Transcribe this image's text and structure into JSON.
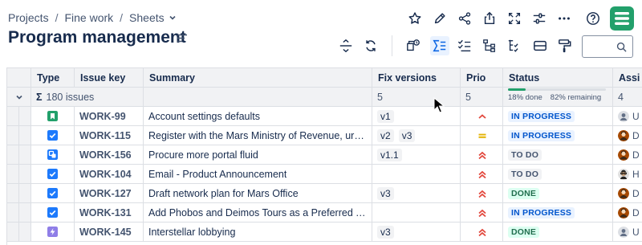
{
  "breadcrumb": {
    "items": [
      "Projects",
      "Fine work",
      "Sheets"
    ],
    "separator": "/"
  },
  "page": {
    "title": "Program management"
  },
  "search": {
    "value": ""
  },
  "icons": {
    "top": [
      "star-icon",
      "edit-icon",
      "share-icon",
      "export-icon",
      "fullscreen-icon",
      "settings-sliders-icon",
      "more-icon",
      "help-icon"
    ],
    "toolbar": [
      "expand-collapse-icon",
      "refresh-icon",
      "filter-icon",
      "sum-icon",
      "checklist-icon",
      "hierarchy-icon",
      "group-icon",
      "card-icon",
      "paint-roller-icon"
    ]
  },
  "colors": {
    "accent": "#0c66e4",
    "brand": "#22a06b",
    "done": "#216e4e",
    "inprogress": "#0055cc"
  },
  "grid": {
    "columns": {
      "type": "Type",
      "key": "Issue key",
      "summary": "Summary",
      "fix_versions": "Fix versions",
      "prio": "Prio",
      "status": "Status",
      "assignee": "Assi"
    },
    "summary_row": {
      "sigma": "Σ",
      "issues": "180 issues",
      "fix_versions_count": "5",
      "prio_count": "5",
      "status_done_label": "18% done",
      "status_remaining_label": "82% remaining",
      "done_fraction": 0.18,
      "assignee_count": "4"
    },
    "rows": [
      {
        "type": "story",
        "key": "WORK-99",
        "summary": "Account settings defaults",
        "versions": [
          "v1"
        ],
        "priority": "medium",
        "status": "IN PROGRESS",
        "status_kind": "inprogress",
        "assignee_avatar": "generic",
        "assignee": "U"
      },
      {
        "type": "task",
        "key": "WORK-115",
        "summary": "Register with the Mars Ministry of Revenue, urge...",
        "versions": [
          "v2",
          "v3"
        ],
        "priority": "medium-equal",
        "status": "IN PROGRESS",
        "status_kind": "inprogress",
        "assignee_avatar": "person",
        "assignee": "D"
      },
      {
        "type": "subtask",
        "key": "WORK-156",
        "summary": "Procure more portal fluid",
        "versions": [
          "v1.1"
        ],
        "priority": "high",
        "status": "TO DO",
        "status_kind": "todo",
        "assignee_avatar": "person",
        "assignee": "D"
      },
      {
        "type": "task",
        "key": "WORK-104",
        "summary": "Email - Product Announcement",
        "versions": [],
        "priority": "high",
        "status": "TO DO",
        "status_kind": "todo",
        "assignee_avatar": "glasses",
        "assignee": "H"
      },
      {
        "type": "task",
        "key": "WORK-127",
        "summary": "Draft network plan for Mars Office",
        "versions": [
          "v3"
        ],
        "priority": "high",
        "status": "DONE",
        "status_kind": "done",
        "assignee_avatar": "person",
        "assignee": "D"
      },
      {
        "type": "task",
        "key": "WORK-131",
        "summary": "Add Phobos and Deimos Tours as a Preferred Tra...",
        "versions": [],
        "priority": "high",
        "status": "IN PROGRESS",
        "status_kind": "inprogress",
        "assignee_avatar": "person",
        "assignee": "D"
      },
      {
        "type": "epic",
        "key": "WORK-145",
        "summary": "Interstellar lobbying",
        "versions": [
          "v3"
        ],
        "priority": "high",
        "status": "DONE",
        "status_kind": "done",
        "assignee_avatar": "generic",
        "assignee": "U"
      }
    ]
  }
}
